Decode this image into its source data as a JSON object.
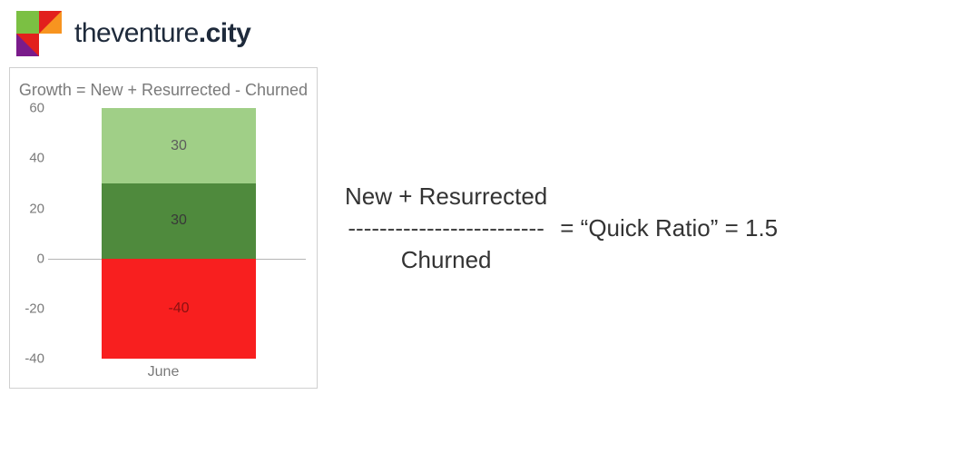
{
  "brand": {
    "part1": "theventure",
    "dot": ".",
    "part2": "city"
  },
  "chart_data": {
    "type": "bar",
    "title": "Growth = New + Resurrected - Churned",
    "categories": [
      "June"
    ],
    "series": [
      {
        "name": "Resurrected",
        "values": [
          30
        ],
        "color": "#a0cf87"
      },
      {
        "name": "New",
        "values": [
          30
        ],
        "color": "#4f8a3d"
      },
      {
        "name": "Churned",
        "values": [
          -40
        ],
        "color": "#f81f1f"
      }
    ],
    "ylim": [
      -40,
      60
    ],
    "yticks": [
      -40,
      -20,
      0,
      20,
      40,
      60
    ],
    "data_labels": {
      "resurrected": "30",
      "new": "30",
      "churned": "-40"
    },
    "xlabel": "",
    "ylabel": ""
  },
  "formula": {
    "numerator": "New + Resurrected",
    "divider": "-------------------------",
    "denominator": "Churned",
    "equals_label": "= “Quick Ratio” = 1.5"
  }
}
